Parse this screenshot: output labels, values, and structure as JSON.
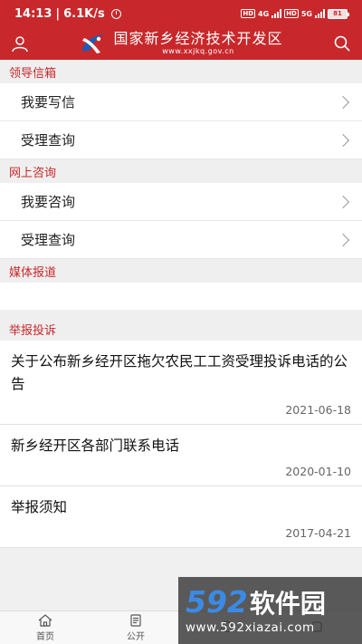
{
  "status_bar": {
    "time": "14:13",
    "speed": "6.1K/s",
    "hd1": "HD",
    "net1": "4G",
    "hd2": "HD",
    "net2": "5G",
    "battery": "81"
  },
  "header": {
    "title": "国家新乡经济技术开发区",
    "subtitle": "www.xxjkq.gov.cn",
    "user_icon": "user-icon",
    "search_icon": "search-icon"
  },
  "sections": {
    "letters": {
      "title": "领导信箱",
      "items": [
        {
          "label": "我要写信"
        },
        {
          "label": "受理查询"
        }
      ]
    },
    "consult": {
      "title": "网上咨询",
      "items": [
        {
          "label": "我要咨询"
        },
        {
          "label": "受理查询"
        }
      ]
    },
    "media": {
      "title": "媒体报道"
    },
    "complaint": {
      "title": "举报投诉",
      "news": [
        {
          "title": "关于公布新乡经开区拖欠农民工工资受理投诉电话的公告",
          "date": "2021-06-18"
        },
        {
          "title": "新乡经开区各部门联系电话",
          "date": "2020-01-10"
        },
        {
          "title": "举报须知",
          "date": "2017-04-21"
        }
      ]
    }
  },
  "bottom_nav": [
    {
      "label": "首页",
      "icon": "home-icon"
    },
    {
      "label": "公开",
      "icon": "document-icon"
    },
    {
      "label": "",
      "icon": "interaction-icon"
    },
    {
      "label": "",
      "icon": "service-icon"
    }
  ],
  "watermark": {
    "number": "592",
    "text": "软件园",
    "url": "www.592xiazai.com"
  },
  "colors": {
    "brand_red": "#c8282b",
    "section_bg": "#efefef",
    "watermark_blue": "#3b8ae6"
  }
}
